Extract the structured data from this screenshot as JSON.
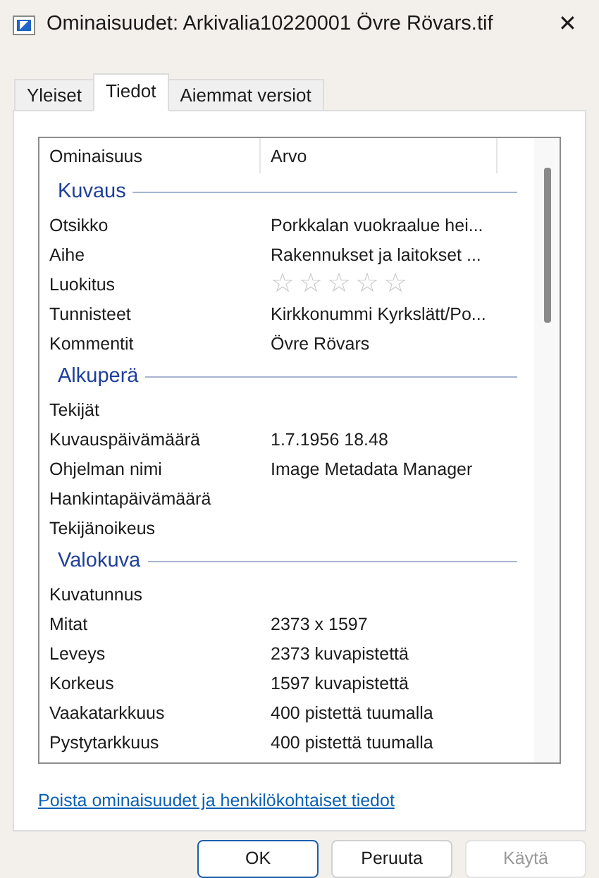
{
  "window": {
    "title": "Ominaisuudet: Arkivalia10220001 Övre Rövars.tif",
    "close": "✕"
  },
  "tabs": [
    {
      "label": "Yleiset",
      "selected": false
    },
    {
      "label": "Tiedot",
      "selected": true
    },
    {
      "label": "Aiemmat versiot",
      "selected": false
    }
  ],
  "table": {
    "columns": [
      "Ominaisuus",
      "Arvo"
    ],
    "sections": [
      {
        "title": "Kuvaus",
        "rows": [
          {
            "kind": "text",
            "name": "Otsikko",
            "value": "Porkkalan vuokraalue hei..."
          },
          {
            "kind": "text",
            "name": "Aihe",
            "value": "Rakennukset ja laitokset ..."
          },
          {
            "kind": "rating",
            "name": "Luokitus",
            "stars": 0
          },
          {
            "kind": "text",
            "name": "Tunnisteet",
            "value": "Kirkkonummi Kyrkslätt/Po..."
          },
          {
            "kind": "text",
            "name": "Kommentit",
            "value": "Övre Rövars"
          }
        ]
      },
      {
        "title": "Alkuperä",
        "rows": [
          {
            "kind": "text",
            "name": "Tekijät"
          },
          {
            "kind": "text",
            "name": "Kuvauspäivämäärä",
            "value": "1.7.1956 18.48"
          },
          {
            "kind": "text",
            "name": "Ohjelman nimi",
            "value": "Image Metadata Manager"
          },
          {
            "kind": "text",
            "name": "Hankintapäivämäärä"
          },
          {
            "kind": "text",
            "name": "Tekijänoikeus"
          }
        ]
      },
      {
        "title": "Valokuva",
        "rows": [
          {
            "kind": "text",
            "name": "Kuvatunnus"
          },
          {
            "kind": "text",
            "name": "Mitat",
            "value": "2373 x 1597"
          },
          {
            "kind": "text",
            "name": "Leveys",
            "value": "2373 kuvapistettä"
          },
          {
            "kind": "text",
            "name": "Korkeus",
            "value": "1597 kuvapistettä"
          },
          {
            "kind": "text",
            "name": "Vaakatarkkuus",
            "value": "400 pistettä tuumalla"
          },
          {
            "kind": "text",
            "name": "Pystytarkkuus",
            "value": "400 pistettä tuumalla"
          }
        ]
      }
    ]
  },
  "link": "Poista ominaisuudet ja henkilökohtaiset tiedot",
  "buttons": [
    {
      "label": "OK",
      "kind": "default",
      "disabled": false
    },
    {
      "label": "Peruuta",
      "kind": "normal",
      "disabled": false
    },
    {
      "label": "Käytä",
      "kind": "normal",
      "disabled": true
    }
  ]
}
